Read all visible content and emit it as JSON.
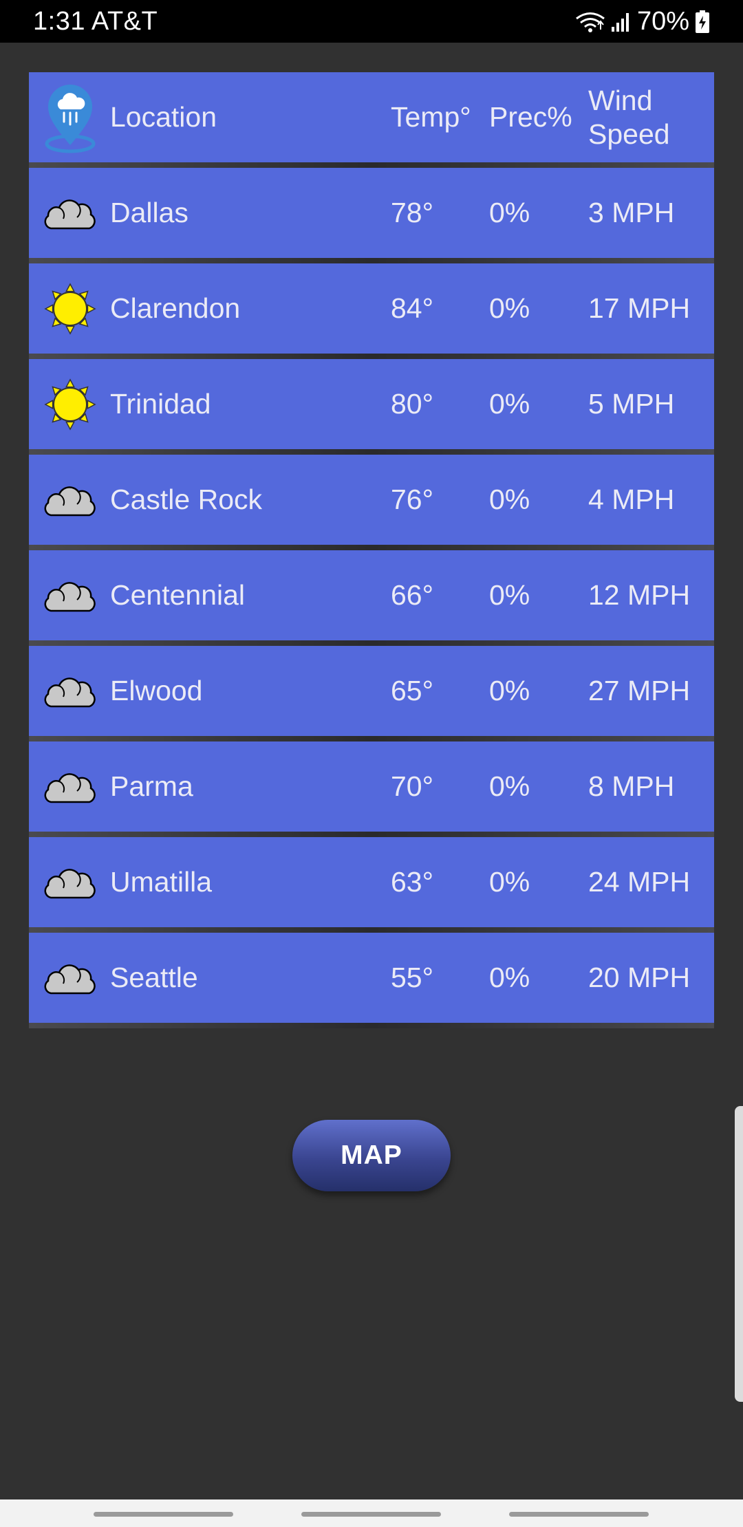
{
  "status_bar": {
    "time_carrier": "1:31 AT&T",
    "battery": "70%"
  },
  "colors": {
    "row_bg": "#5469dc",
    "page_bg": "#313131",
    "cloud": "#c8c8c8",
    "sun": "#ffee00"
  },
  "table": {
    "header": {
      "icon": "rain-location-pin-icon",
      "location": "Location",
      "temp": "Temp°",
      "prec": "Prec%",
      "wind": "Wind Speed"
    },
    "rows": [
      {
        "icon": "cloud-icon",
        "location": "Dallas",
        "temp": "78°",
        "prec": "0%",
        "wind": "3 MPH"
      },
      {
        "icon": "sun-icon",
        "location": "Clarendon",
        "temp": "84°",
        "prec": "0%",
        "wind": "17 MPH"
      },
      {
        "icon": "sun-icon",
        "location": "Trinidad",
        "temp": "80°",
        "prec": "0%",
        "wind": "5 MPH"
      },
      {
        "icon": "cloud-icon",
        "location": "Castle Rock",
        "temp": "76°",
        "prec": "0%",
        "wind": "4 MPH"
      },
      {
        "icon": "cloud-icon",
        "location": "Centennial",
        "temp": "66°",
        "prec": "0%",
        "wind": "12 MPH"
      },
      {
        "icon": "cloud-icon",
        "location": "Elwood",
        "temp": "65°",
        "prec": "0%",
        "wind": "27 MPH"
      },
      {
        "icon": "cloud-icon",
        "location": "Parma",
        "temp": "70°",
        "prec": "0%",
        "wind": "8 MPH"
      },
      {
        "icon": "cloud-icon",
        "location": "Umatilla",
        "temp": "63°",
        "prec": "0%",
        "wind": "24 MPH"
      },
      {
        "icon": "cloud-icon",
        "location": "Seattle",
        "temp": "55°",
        "prec": "0%",
        "wind": "20 MPH"
      }
    ]
  },
  "map_button": {
    "label": "MAP"
  }
}
